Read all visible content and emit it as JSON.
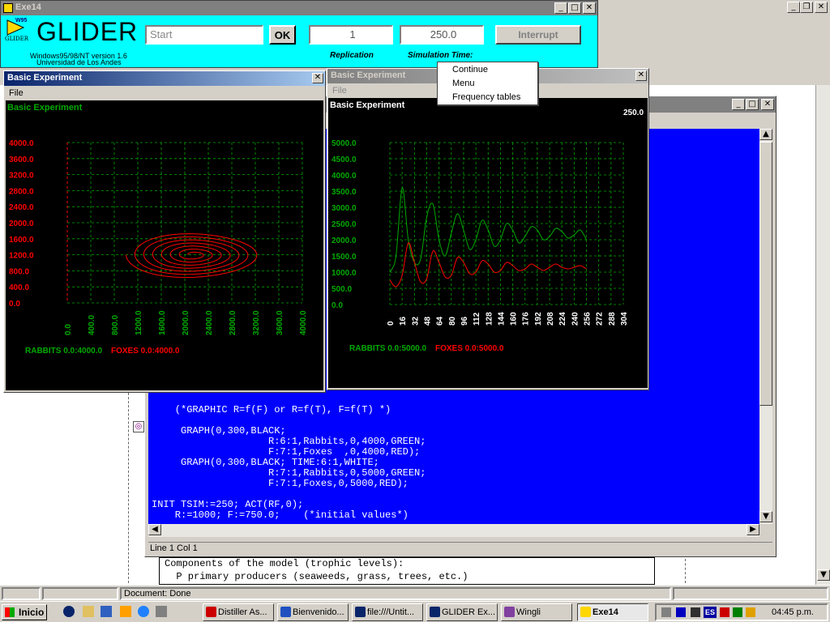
{
  "glider_window": {
    "title": "Exe14",
    "logo_text": "GLIDER",
    "logo_small": "W95",
    "version_line1": "Windows95/98/NT version 1.6",
    "version_line2": "Universidad de Los Andes",
    "start_placeholder": "Start",
    "ok_label": "OK",
    "replication_value": "1",
    "simulation_time_value": "250.0",
    "interrupt_label": "Interrupt",
    "replication_label": "Replication",
    "simulation_time_label": "Simulation Time:",
    "bg_color": "#00ffff"
  },
  "context_menu": {
    "items": [
      "Continue",
      "Menu",
      "Frequency tables"
    ]
  },
  "left_chart_window": {
    "title": "Basic Experiment",
    "menu_file": "File",
    "chart_title": "Basic Experiment",
    "legend_rabbits": "RABBITS  0.0:4000.0",
    "legend_foxes": "FOXES  0.0:4000.0",
    "y_ticks": [
      "4000.0",
      "3600.0",
      "3200.0",
      "2800.0",
      "2400.0",
      "2000.0",
      "1600.0",
      "1200.0",
      "800.0",
      "400.0",
      "0.0"
    ],
    "x_ticks": [
      "0.0",
      "400.0",
      "800.0",
      "1200.0",
      "1600.0",
      "2000.0",
      "2400.0",
      "2800.0",
      "3200.0",
      "3600.0",
      "4000.0"
    ]
  },
  "right_chart_window": {
    "title": "Basic Experiment",
    "menu_file": "File",
    "chart_title": "Basic Experiment",
    "time_value": "250.0",
    "legend_rabbits": "RABBITS  0.0:5000.0",
    "legend_foxes": "FOXES  0.0:5000.0",
    "y_ticks": [
      "5000.0",
      "4500.0",
      "4000.0",
      "3500.0",
      "3000.0",
      "2500.0",
      "2000.0",
      "1500.0",
      "1000.0",
      "500.0",
      "0.0"
    ],
    "x_ticks": [
      "0",
      "16",
      "32",
      "48",
      "64",
      "80",
      "96",
      "112",
      "128",
      "144",
      "160",
      "176",
      "192",
      "208",
      "224",
      "240",
      "256",
      "272",
      "288",
      "304"
    ]
  },
  "chart_data": [
    {
      "type": "line",
      "title": "Basic Experiment",
      "xlabel": "",
      "ylabel": "",
      "xlim": [
        0,
        4000
      ],
      "ylim": [
        0,
        4000
      ],
      "series": [
        {
          "name": "RABBITS vs FOXES",
          "color": "#ff0000",
          "x": [
            1000,
            1700,
            2300,
            2100,
            1800,
            1700,
            2000,
            2250,
            2200,
            1950,
            1900,
            2100,
            2150
          ],
          "y": [
            750,
            600,
            1100,
            1600,
            1400,
            1150,
            900,
            1200,
            1400,
            1250,
            1150,
            1200,
            1250
          ]
        }
      ]
    },
    {
      "type": "line",
      "title": "Basic Experiment",
      "xlabel": "",
      "ylabel": "",
      "xlim": [
        0,
        304
      ],
      "ylim": [
        0,
        5000
      ],
      "x": [
        0,
        8,
        16,
        24,
        32,
        40,
        48,
        56,
        64,
        72,
        80,
        88,
        96,
        104,
        112,
        120,
        128,
        136,
        144,
        152,
        160,
        168,
        176,
        184,
        192,
        200,
        208,
        216,
        224,
        232,
        240,
        248,
        256
      ],
      "series": [
        {
          "name": "RABBITS",
          "color": "#00aa00",
          "values": [
            1000,
            1500,
            3600,
            2000,
            1300,
            1400,
            2700,
            3100,
            2000,
            1500,
            2200,
            2800,
            2300,
            1700,
            2000,
            2600,
            2300,
            1800,
            2000,
            2500,
            2300,
            1900,
            2100,
            2400,
            2300,
            2000,
            2100,
            2350,
            2250,
            2050,
            2150,
            2300,
            2000
          ]
        },
        {
          "name": "FOXES",
          "color": "#ff0000",
          "values": [
            750,
            550,
            900,
            1900,
            1300,
            700,
            800,
            1650,
            1300,
            850,
            900,
            1450,
            1300,
            950,
            1000,
            1350,
            1250,
            1000,
            1050,
            1300,
            1200,
            1050,
            1100,
            1250,
            1150,
            1050,
            1150,
            1250,
            1150,
            1100,
            1150,
            1200,
            1100
          ]
        }
      ]
    }
  ],
  "editor": {
    "code_lines": [
      "    (*GRAPHIC R=f(F) or R=f(T), F=f(T) *)",
      "",
      "     GRAPH(0,300,BLACK;",
      "                    R:6:1,Rabbits,0,4000,GREEN;",
      "                    F:7:1,Foxes  ,0,4000,RED);",
      "     GRAPH(0,300,BLACK; TIME:6:1,WHITE;",
      "                    R:7:1,Rabbits,0,5000,GREEN;",
      "                    F:7:1,Foxes,0,5000,RED);",
      "",
      "INIT TSIM:=250; ACT(RF,0);",
      "    R:=1000; F:=750.0;    (*initial values*)"
    ],
    "status": "Line 1 Col 1"
  },
  "background_doc": {
    "line1": "Components of the model (trophic levels):",
    "line2": "  P primary producers (seaweeds, grass, trees, etc.)"
  },
  "browser_status": "Document: Done",
  "taskbar": {
    "start_label": "Inicio",
    "buttons": [
      "Distiller As...",
      "Bienvenido...",
      "file:///Untit...",
      "GLIDER Ex...",
      "Wingli",
      "Exe14"
    ],
    "lang": "ES",
    "clock": "04:45 p.m."
  }
}
